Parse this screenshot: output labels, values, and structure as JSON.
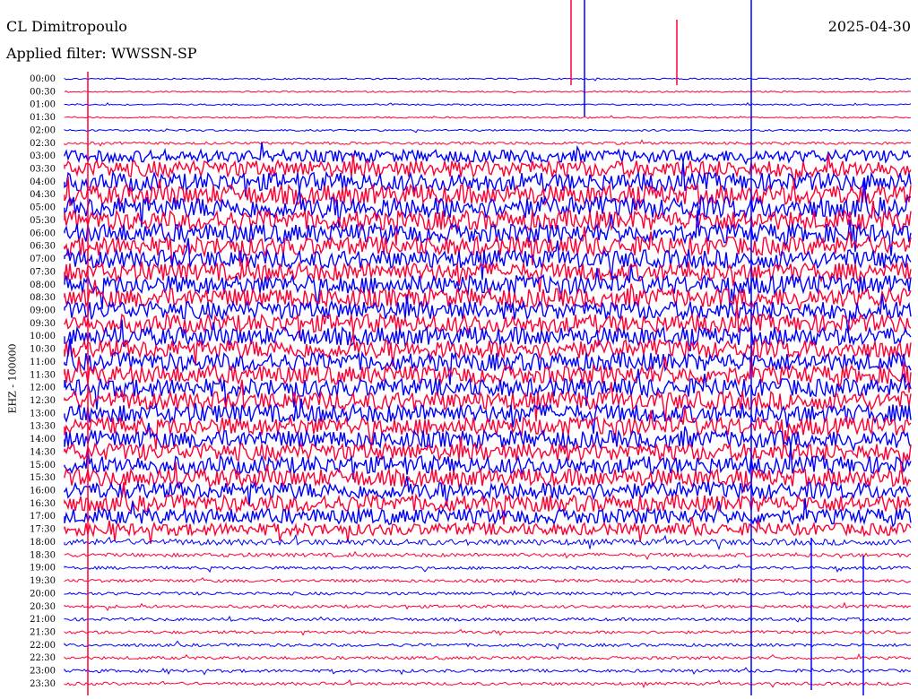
{
  "header": {
    "station": "CL Dimitropoulo",
    "date": "2025-04-30",
    "filter": "Applied filter: WWSSN-SP"
  },
  "chart_data": {
    "type": "line",
    "title": "CL Dimitropoulo",
    "ylabel": "EHZ - 100000",
    "time_labels": [
      "00:00",
      "00:30",
      "01:00",
      "01:30",
      "02:00",
      "02:30",
      "03:00",
      "03:30",
      "04:00",
      "04:30",
      "05:00",
      "05:30",
      "06:00",
      "06:30",
      "07:00",
      "07:30",
      "08:00",
      "08:30",
      "09:00",
      "09:30",
      "10:00",
      "10:30",
      "11:00",
      "11:30",
      "12:00",
      "12:30",
      "13:00",
      "13:30",
      "14:00",
      "14:30",
      "15:00",
      "15:30",
      "16:00",
      "16:30",
      "17:00",
      "17:30",
      "18:00",
      "18:30",
      "19:00",
      "19:30",
      "20:00",
      "20:30",
      "21:00",
      "21:30",
      "22:00",
      "22:30",
      "23:00",
      "23:30"
    ],
    "trace_colors": [
      "#0000ff",
      "#ff0033"
    ],
    "noise_amplitude": [
      0.2,
      0.2,
      0.2,
      0.2,
      0.25,
      0.35,
      1.6,
      2.2,
      2.4,
      2.6,
      2.8,
      2.6,
      2.5,
      2.5,
      2.4,
      2.4,
      2.5,
      2.5,
      2.4,
      2.4,
      2.4,
      2.4,
      2.4,
      2.4,
      2.4,
      2.4,
      2.4,
      2.4,
      2.3,
      2.3,
      2.3,
      2.3,
      2.2,
      2.2,
      2.0,
      1.6,
      0.8,
      0.5,
      0.4,
      0.4,
      0.4,
      0.4,
      0.4,
      0.4,
      0.4,
      0.4,
      0.4,
      0.4
    ],
    "grid": false
  }
}
